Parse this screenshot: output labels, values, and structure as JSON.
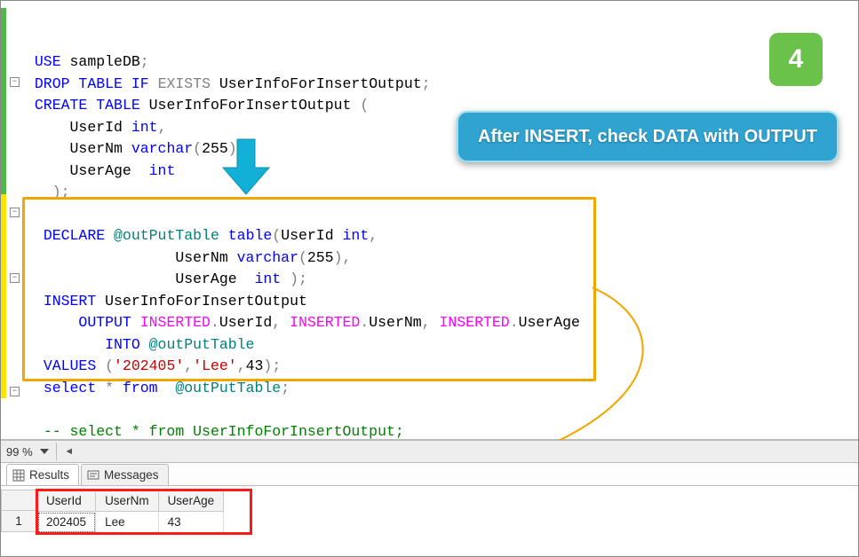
{
  "badge": {
    "number": "4"
  },
  "callout": {
    "text": "After INSERT, check DATA with OUTPUT"
  },
  "zoom": {
    "value": "99 %"
  },
  "tabs": {
    "results": "Results",
    "messages": "Messages"
  },
  "sql": {
    "l1_use": "USE",
    "l1_db": "sampleDB",
    "semi": ";",
    "drop": "DROP",
    "table": "TABLE",
    "if": "IF",
    "exists": "EXISTS",
    "tblname": "UserInfoForInsertOutput",
    "create": "CREATE",
    "lpar": "(",
    "rpar": ")",
    "col1": "UserId",
    "int": "int",
    "comma": ",",
    "col2": "UserNm",
    "varchar": "varchar",
    "vlen": "255",
    "col3": "UserAge",
    "declare": "DECLARE",
    "var1": "@outPutTable",
    "tabletype": "table",
    "insert": "INSERT",
    "output": "OUTPUT",
    "inserted": "INSERTED",
    "dot": ".",
    "into": "INTO",
    "values": "VALUES",
    "v1": "'202405'",
    "v2": "'Lee'",
    "v3": "43",
    "select": "select",
    "star": "*",
    "from": "from",
    "comment": "-- select * from UserInfoForInsertOutput;"
  },
  "results": {
    "rownum": "1",
    "headers": {
      "c1": "UserId",
      "c2": "UserNm",
      "c3": "UserAge"
    },
    "row1": {
      "c1": "202405",
      "c2": "Lee",
      "c3": "43"
    }
  }
}
